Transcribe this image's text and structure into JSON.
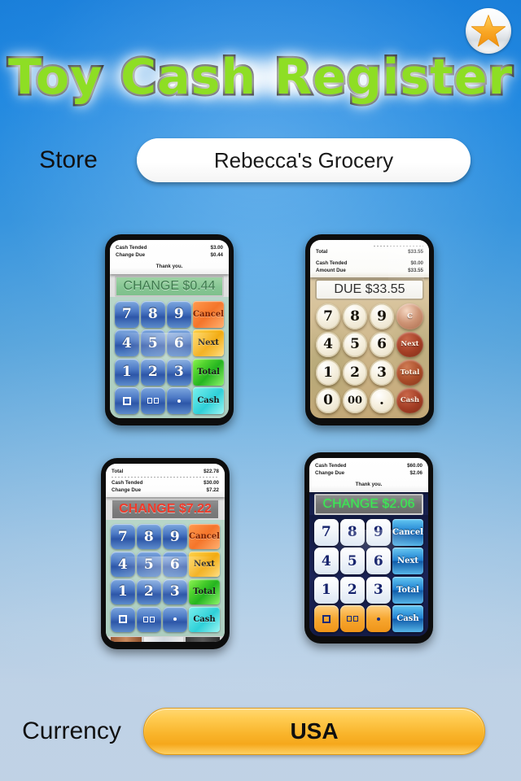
{
  "app": {
    "title": "Toy Cash Register",
    "title_color": "#8ede24",
    "background_top_color": "#1683e4",
    "background_bottom_color": "#d6e5f5"
  },
  "badge": {
    "icon": "star-icon",
    "color": "#f5a623"
  },
  "store": {
    "label": "Store",
    "value": "Rebecca's Grocery",
    "placeholder": "Store name"
  },
  "currency": {
    "label": "Currency",
    "value": "USA",
    "button_color": "#f9b52b"
  },
  "keypad": {
    "numbers_row1": [
      "7",
      "8",
      "9"
    ],
    "numbers_row2": [
      "4",
      "5",
      "6"
    ],
    "numbers_row3": [
      "1",
      "2",
      "3"
    ],
    "functions": [
      "Cancel",
      "Next",
      "Total",
      "Cash"
    ]
  },
  "registers": [
    {
      "name": "classic-silver-register",
      "theme": "light-silver",
      "bottom_row": [
        "0",
        "00",
        "."
      ],
      "bottom_row_style": "icon",
      "functions": [
        "Cancel",
        "Next",
        "Total",
        "Cash"
      ],
      "display": "CHANGE $0.44",
      "display_color": "#3e7a4d",
      "receipt": {
        "rows": [
          {
            "label": "Cash Tended",
            "value": "$3.00"
          },
          {
            "label": "Change Due",
            "value": "$0.44"
          }
        ],
        "footer": "Thank you."
      }
    },
    {
      "name": "vintage-register",
      "theme": "vintage-parchment",
      "bottom_row": [
        "0",
        "00",
        "."
      ],
      "bottom_row_style": "text",
      "functions": [
        "C",
        "Next",
        "Total",
        "Cash"
      ],
      "display": "DUE $33.55",
      "display_color": "#2f2f2f",
      "receipt": {
        "rows": [
          {
            "label": "Total",
            "value": "$33.55"
          },
          {
            "label": "Cash Tended",
            "value": "$0.00"
          },
          {
            "label": "Amount Due",
            "value": "$33.55"
          }
        ],
        "footer": ""
      }
    },
    {
      "name": "white-register",
      "theme": "light-silver",
      "bottom_row": [
        "0",
        "00",
        "."
      ],
      "bottom_row_style": "icon",
      "functions": [
        "Cancel",
        "Next",
        "Total",
        "Cash"
      ],
      "display": "CHANGE $7.22",
      "display_color": "#f03a2a",
      "receipt": {
        "rows": [
          {
            "label": "Total",
            "value": "$22.78"
          },
          {
            "label": "Cash Tended",
            "value": "$30.00"
          },
          {
            "label": "Change Due",
            "value": "$7.22"
          }
        ],
        "footer": ""
      }
    },
    {
      "name": "navy-register",
      "theme": "dark-navy",
      "bottom_row": [
        "0",
        "00",
        "."
      ],
      "bottom_row_style": "icon",
      "functions": [
        "Cancel",
        "Next",
        "Total",
        "Cash"
      ],
      "display": "CHANGE $2.06",
      "display_color": "#38ef52",
      "receipt": {
        "rows": [
          {
            "label": "Cash Tended",
            "value": "$60.00"
          },
          {
            "label": "Change Due",
            "value": "$2.06"
          }
        ],
        "footer": "Thank you."
      }
    }
  ]
}
